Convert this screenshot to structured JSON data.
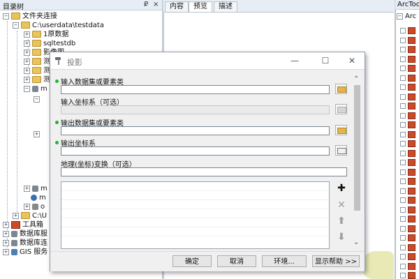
{
  "catalog": {
    "title": "目录树",
    "pin": "₽",
    "close": "×",
    "items": [
      {
        "label": "文件夹连接"
      },
      {
        "label": "C:\\userdata\\testdata"
      },
      {
        "label": "1原数据"
      },
      {
        "label": "sqltestdb"
      },
      {
        "label": "影像图"
      },
      {
        "label": "测"
      },
      {
        "label": "测"
      },
      {
        "label": "测"
      },
      {
        "label": "m"
      },
      {
        "label": "m"
      },
      {
        "label": "m"
      },
      {
        "label": "o"
      },
      {
        "label": "C:\\U"
      },
      {
        "label": "工具箱"
      },
      {
        "label": "数据库服"
      },
      {
        "label": "数据库连"
      },
      {
        "label": "GIS 服务"
      }
    ]
  },
  "preview": {
    "tabs": [
      "内容",
      "预览",
      "描述"
    ]
  },
  "arctoolbox": {
    "title": "ArcToo",
    "root": "Arc"
  },
  "dialog": {
    "title": "投影",
    "minimize": "—",
    "maximize": "☐",
    "close": "✕",
    "params": {
      "input_dataset": "输入数据集或要素类",
      "input_crs": "输入坐标系（可选）",
      "output_dataset": "输出数据集或要素类",
      "output_crs": "输出坐标系",
      "geo_transform": "地理(坐标)变换（可选）"
    },
    "side_buttons": {
      "add": "✚",
      "remove": "✕",
      "up": "⬆",
      "down": "⬇"
    },
    "buttons": {
      "ok": "确定",
      "cancel": "取消",
      "env": "环境...",
      "help": "显示帮助 >>"
    }
  },
  "colors": {
    "required_dot": "#21b531",
    "toolbox": "#c94b2a"
  }
}
